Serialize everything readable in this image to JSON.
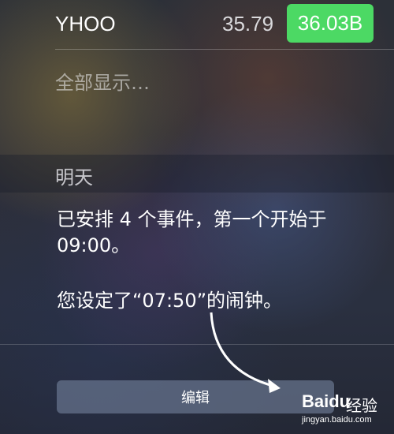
{
  "stock": {
    "symbol": "YHOO",
    "price": "35.79",
    "market_cap": "36.03B",
    "badge_color": "#4cd964"
  },
  "show_all": "全部显示…",
  "tomorrow": {
    "title": "明天",
    "event_summary": "已安排 4 个事件，第一个开始于 09:00。",
    "alarm": "您设定了“07:50”的闹钟。"
  },
  "edit_button": "编辑",
  "watermark": {
    "logo": "Baidu",
    "text": "经验",
    "url": "jingyan.baidu.com"
  }
}
